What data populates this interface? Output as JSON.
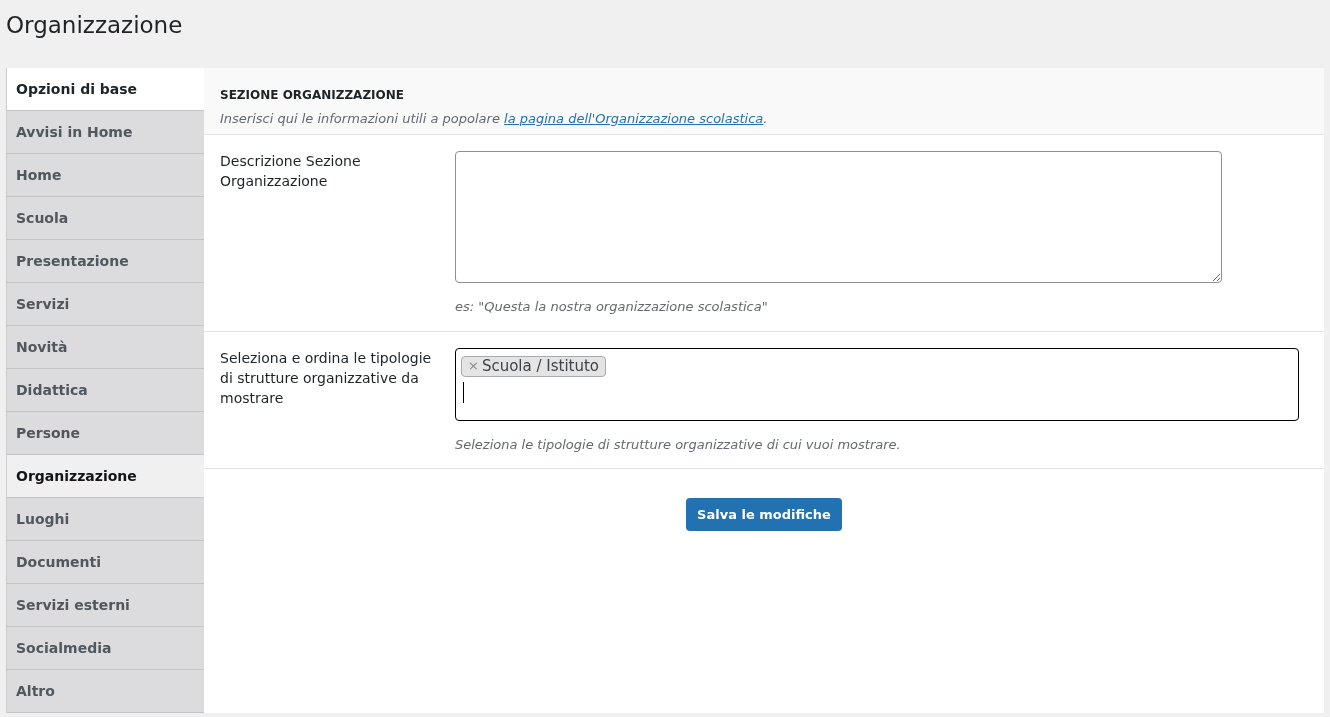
{
  "page_title": "Organizzazione",
  "sidebar": {
    "items": [
      {
        "label": "Opzioni di base",
        "kind": "main",
        "selected": false
      },
      {
        "label": "Avvisi in Home",
        "kind": "tab",
        "selected": false
      },
      {
        "label": "Home",
        "kind": "tab",
        "selected": false
      },
      {
        "label": "Scuola",
        "kind": "tab",
        "selected": false
      },
      {
        "label": "Presentazione",
        "kind": "tab",
        "selected": false
      },
      {
        "label": "Servizi",
        "kind": "tab",
        "selected": false
      },
      {
        "label": "Novità",
        "kind": "tab",
        "selected": false
      },
      {
        "label": "Didattica",
        "kind": "tab",
        "selected": false
      },
      {
        "label": "Persone",
        "kind": "tab",
        "selected": false
      },
      {
        "label": "Organizzazione",
        "kind": "tab",
        "selected": true
      },
      {
        "label": "Luoghi",
        "kind": "tab",
        "selected": false
      },
      {
        "label": "Documenti",
        "kind": "tab",
        "selected": false
      },
      {
        "label": "Servizi esterni",
        "kind": "tab",
        "selected": false
      },
      {
        "label": "Socialmedia",
        "kind": "tab",
        "selected": false
      },
      {
        "label": "Altro",
        "kind": "tab",
        "selected": false
      }
    ]
  },
  "section": {
    "title": "SEZIONE ORGANIZZAZIONE",
    "description": "Inserisci qui le informazioni utili a popolare",
    "link": "la pagina dell'Organizzazione scolastica",
    "after_link": "."
  },
  "fields": [
    {
      "kind": "textarea",
      "label": "Descrizione Sezione Organizzazione",
      "hint": "es: \"Questa la nostra organizzazione scolastica\""
    },
    {
      "kind": "multiselect",
      "label": "Seleziona e ordina le tipologie di strutture organizzative da mostrare",
      "tags": [
        {
          "remove": "×",
          "label": "Scuola / Istituto"
        }
      ],
      "hint": "Seleziona le tipologie di strutture organizzative di cui vuoi mostrare."
    }
  ],
  "save_button": "Salva le modifiche"
}
